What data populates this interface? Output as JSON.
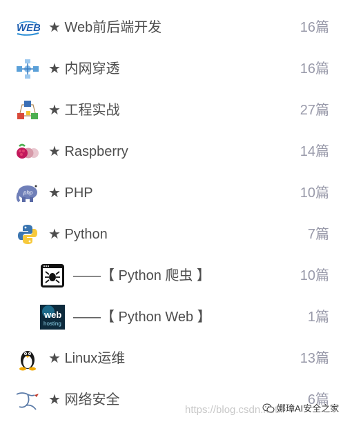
{
  "items": [
    {
      "label": "★ Web前后端开发",
      "count": "16篇",
      "icon": "web-logo-icon"
    },
    {
      "label": "★ 内网穿透",
      "count": "16篇",
      "icon": "network-icon"
    },
    {
      "label": "★ 工程实战",
      "count": "27篇",
      "icon": "blocks-icon"
    },
    {
      "label": "★ Raspberry",
      "count": "14篇",
      "icon": "raspberry-icon"
    },
    {
      "label": "★ PHP",
      "count": "10篇",
      "icon": "php-elephant-icon"
    },
    {
      "label": "★ Python",
      "count": "7篇",
      "icon": "python-icon"
    },
    {
      "label": "——【 Python 爬虫 】",
      "count": "10篇",
      "icon": "spider-icon"
    },
    {
      "label": "——【 Python Web 】",
      "count": "1篇",
      "icon": "web-hosting-icon"
    },
    {
      "label": "★ Linux运维",
      "count": "13篇",
      "icon": "tux-penguin-icon"
    },
    {
      "label": "★ 网络安全",
      "count": "6篇",
      "icon": "kali-dragon-icon"
    }
  ],
  "watermark": {
    "url": "https://blog.csdn.net/",
    "brand": "娜璋AI安全之家"
  }
}
